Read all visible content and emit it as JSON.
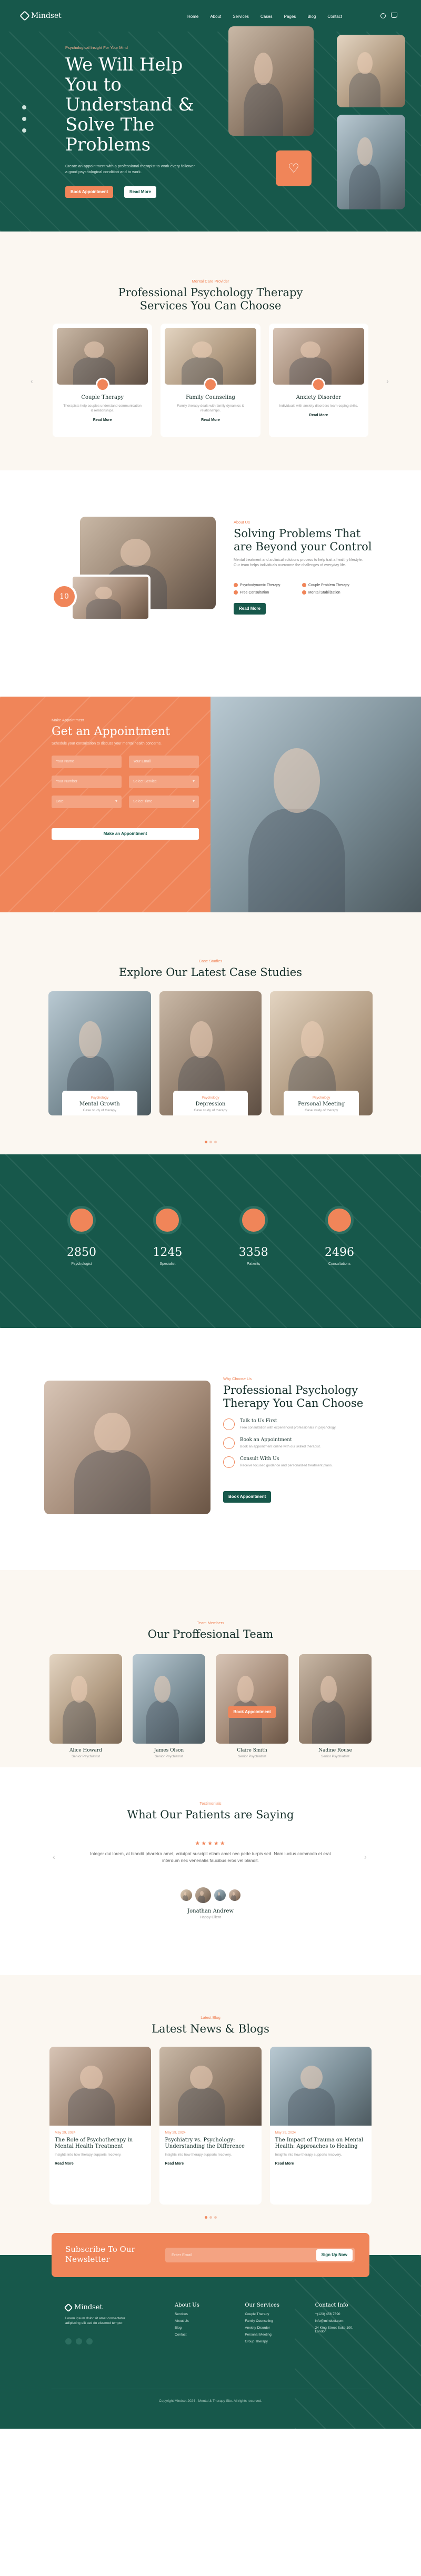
{
  "header": {
    "logo": "Mindset",
    "nav": [
      "Home",
      "About",
      "Services",
      "Cases",
      "Pages",
      "Blog",
      "Contact"
    ]
  },
  "hero": {
    "eyebrow": "Psychological Insight For Your Mind",
    "title": "We Will Help You to Understand & Solve The Problems",
    "desc": "Create an appointment with a professional therapist to work every follower a good psychological condition and to work.",
    "btn1": "Book Appointment",
    "btn2": "Read More"
  },
  "services": {
    "sub": "Mental Care Provider",
    "title": "Professional Psychology Therapy Services You Can Choose",
    "items": [
      {
        "title": "Couple Therapy",
        "desc": "Therapists help couples understand communication & relationships.",
        "link": "Read More"
      },
      {
        "title": "Family Counseling",
        "desc": "Family therapy deals with family dynamics & relationships.",
        "link": "Read More"
      },
      {
        "title": "Anxiety Disorder",
        "desc": "Individuals with anxiety disorders learn coping skills.",
        "link": "Read More"
      }
    ]
  },
  "about": {
    "sub": "About Us",
    "title": "Solving Problems That are Beyond your Control",
    "desc": "Mental treatment and a clinical solutions process to help trait a healthy lifestyle. Our team helps individuals overcome the challenges of everyday life.",
    "checks": [
      "Psychodynamic Therapy",
      "Couple Problem Therapy",
      "Free Consultation",
      "Mental Stabilization"
    ],
    "btn": "Read More",
    "badge": "10"
  },
  "appt": {
    "sub": "Make Appointment",
    "title": "Get an Appointment",
    "desc": "Schedule your consultation to discuss your mental health concerns.",
    "fields": [
      "Your Name",
      "Your Email",
      "Your Number",
      "Select Service",
      "Date",
      "Select Time"
    ],
    "btn": "Make an Appointment"
  },
  "cases": {
    "sub": "Case Studies",
    "title": "Explore Our Latest Case Studies",
    "items": [
      {
        "cat": "Psychology",
        "title": "Mental Growth",
        "desc": "Case study of therapy"
      },
      {
        "cat": "Psychology",
        "title": "Depression",
        "desc": "Case study of therapy"
      },
      {
        "cat": "Psychology",
        "title": "Personal Meeting",
        "desc": "Case study of therapy"
      }
    ]
  },
  "stats": [
    {
      "num": "2850",
      "label": "Psychologist"
    },
    {
      "num": "1245",
      "label": "Specialist"
    },
    {
      "num": "3358",
      "label": "Patients"
    },
    {
      "num": "2496",
      "label": "Consultations"
    }
  ],
  "why": {
    "sub": "Why Choose Us",
    "title": "Professional Psychology Therapy You Can Choose",
    "items": [
      {
        "title": "Talk to Us First",
        "desc": "Free consultation with experienced professionals in psychology."
      },
      {
        "title": "Book an Appointment",
        "desc": "Book an appointment online with our skilled therapist."
      },
      {
        "title": "Consult With Us",
        "desc": "Receive focused guidance and personalized treatment plans."
      }
    ],
    "btn": "Book Appointment"
  },
  "team": {
    "sub": "Team Members",
    "title": "Our Proffesional Team",
    "members": [
      {
        "name": "Alice Howard",
        "role": "Senior Psychiatrist"
      },
      {
        "name": "James Olson",
        "role": "Senior Psychiatrist"
      },
      {
        "name": "Claire Smith",
        "role": "Senior Psychiatrist"
      },
      {
        "name": "Nadine Rouse",
        "role": "Senior Psychiatrist"
      }
    ],
    "overlay": "Book Appointment"
  },
  "testimonials": {
    "sub": "Testimonials",
    "title": "What Our Patients are Saying",
    "stars": "★★★★★",
    "quote": "Integer dui lorem, at blandit pharetra amet, volutpat suscipit etiam amet nec pede turpis sed. Nam luctus commodo et erat interdum nec venenatis faucibus eros vel blandit.",
    "name": "Jonathan Andrew",
    "role": "Happy Client"
  },
  "news": {
    "sub": "Latest Blog",
    "title": "Latest News & Blogs",
    "posts": [
      {
        "date": "May 29, 2024",
        "title": "The Role of Psychotherapy in Mental Health Treatment",
        "desc": "Insights into how therapy supports recovery.",
        "link": "Read More"
      },
      {
        "date": "May 29, 2024",
        "title": "Psychiatry vs. Psychology: Understanding the Difference",
        "desc": "Insights into how therapy supports recovery.",
        "link": "Read More"
      },
      {
        "date": "May 29, 2024",
        "title": "The Impact of Trauma on Mental Health: Approaches to Healing",
        "desc": "Insights into how therapy supports recovery.",
        "link": "Read More"
      }
    ]
  },
  "newsletter": {
    "title": "Subscribe To Our Newsletter",
    "placeholder": "Enter Email",
    "btn": "Sign Up Now"
  },
  "footer": {
    "logo": "Mindset",
    "desc": "Lorem ipsum dolor sit amet consectetur adipiscing elit sed do eiusmod tempor.",
    "cols": [
      {
        "title": "About Us",
        "links": [
          "Services",
          "About Us",
          "Blog",
          "Contact"
        ]
      },
      {
        "title": "Our Services",
        "links": [
          "Couple Therapy",
          "Family Counseling",
          "Anxiety Disorder",
          "Personal Meeting",
          "Group Therapy"
        ]
      },
      {
        "title": "Contact Info",
        "links": [
          "+(123) 456 7890",
          "info@mindset.com",
          "24 King Street Suite 100, London"
        ]
      }
    ],
    "copyright": "Copyright Mindset 2024 - Mental & Therapy Site. All rights reserved."
  }
}
